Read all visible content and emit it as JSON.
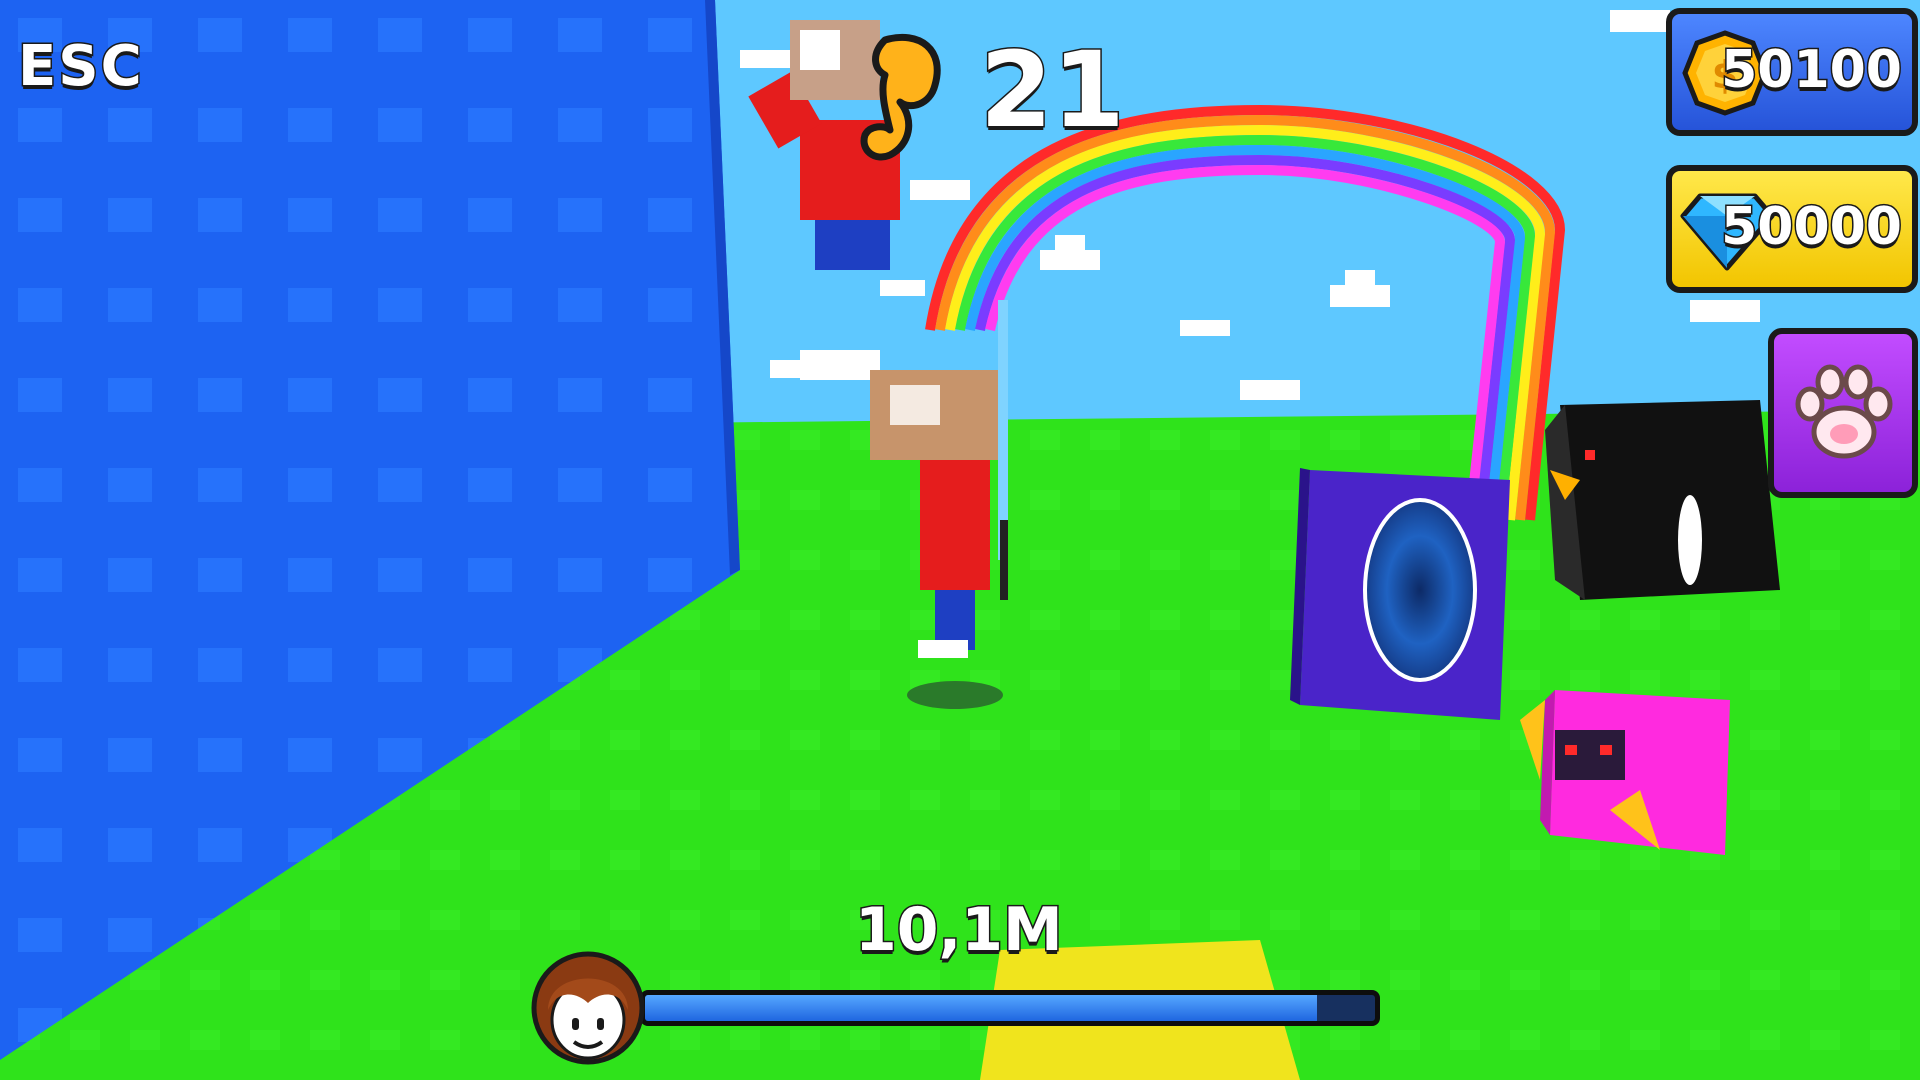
{
  "hud": {
    "esc_label": "ESC",
    "power": {
      "value": "21",
      "icon": "flexed-arm-icon"
    },
    "currencies": {
      "coins": {
        "value": "50100",
        "icon": "coin-icon"
      },
      "gems": {
        "value": "50000",
        "icon": "diamond-icon"
      }
    },
    "pets_button": {
      "icon": "paw-icon"
    },
    "progress": {
      "label": "10,1M",
      "fraction": 0.92,
      "avatar": "player-avatar-icon"
    }
  },
  "colors": {
    "sky": "#5ec8ff",
    "grass": "#2ee51a",
    "wall": "#1b5ff0",
    "coin_panel": "#2f62e6",
    "gem_panel": "#f5cf00",
    "pet_panel": "#a533ef",
    "progress_fill": "#2a77ef"
  }
}
